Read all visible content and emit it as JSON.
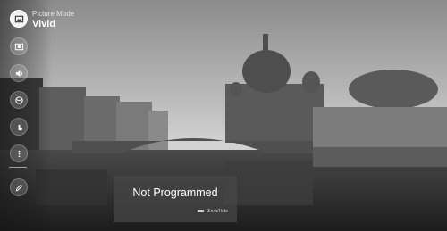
{
  "osd": {
    "label": "Picture Mode",
    "value": "Vivid"
  },
  "sidebar": {
    "items": [
      {
        "icon": "picture-mode-icon",
        "active": true
      },
      {
        "icon": "aspect-ratio-icon",
        "active": false
      },
      {
        "icon": "sound-icon",
        "active": false
      },
      {
        "icon": "sports-icon",
        "active": false
      },
      {
        "icon": "touch-icon",
        "active": false
      },
      {
        "icon": "more-icon",
        "active": false
      },
      {
        "icon": "edit-icon",
        "active": false
      }
    ]
  },
  "popup": {
    "message": "Not Programmed",
    "hint": "Show/Hide"
  }
}
